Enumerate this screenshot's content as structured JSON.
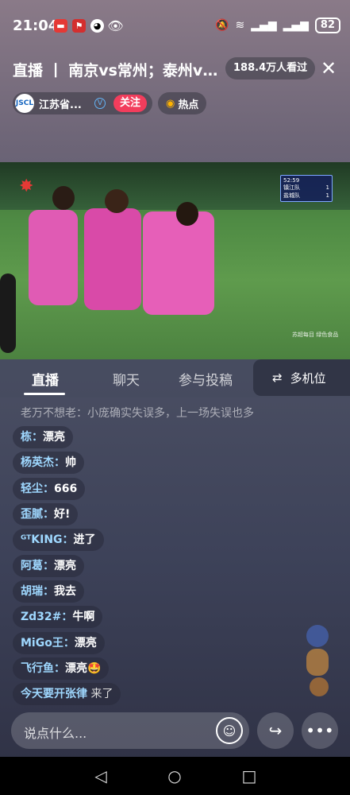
{
  "status_bar": {
    "time": "21:04",
    "battery": "82"
  },
  "header": {
    "title": "直播 丨 南京vs常州；泰州vs...",
    "viewers": "188.4万人看过",
    "close_icon": "close-icon"
  },
  "channel": {
    "name": "江苏省...",
    "follow_label": "关注",
    "hot_label": "热点",
    "logo_text": "JSCL"
  },
  "video": {
    "scoreboard": {
      "clock": "52:59",
      "rows": [
        {
          "team": "镇江队",
          "score": "1"
        },
        {
          "team": "盐城队",
          "score": "1"
        }
      ]
    },
    "badge": "苏超每目 绿色食品"
  },
  "tabs": [
    {
      "label": "直播",
      "active": true
    },
    {
      "label": "聊天",
      "active": false
    },
    {
      "label": "参与投稿",
      "active": false
    }
  ],
  "multi_cam_label": "多机位",
  "chat": {
    "faded_line": "老万不想老：小庞确实失误多，上一场失误也多",
    "messages": [
      {
        "name": "栋：",
        "text": "漂亮"
      },
      {
        "name": "杨英杰：",
        "text": "帅"
      },
      {
        "name": "轻尘：",
        "text": "666"
      },
      {
        "name": "歪腻：",
        "text": "好!"
      },
      {
        "name": "ᴳᵀKING：",
        "text": "进了"
      },
      {
        "name": "阿葛：",
        "text": "漂亮"
      },
      {
        "name": "胡瑞：",
        "text": "我去"
      },
      {
        "name": "Zd32#：",
        "text": "牛啊"
      },
      {
        "name": "MiGo王：",
        "text": "漂亮"
      },
      {
        "name": "飞行鱼：",
        "text": "漂亮🤩"
      },
      {
        "name": "今天要开张律",
        "text": " 来了"
      }
    ]
  },
  "input": {
    "placeholder": "说点什么..."
  },
  "colors": {
    "follow": "#f23d5c",
    "chat_name": "#9fd8ff",
    "accent_jersey": "#e05bb4"
  }
}
